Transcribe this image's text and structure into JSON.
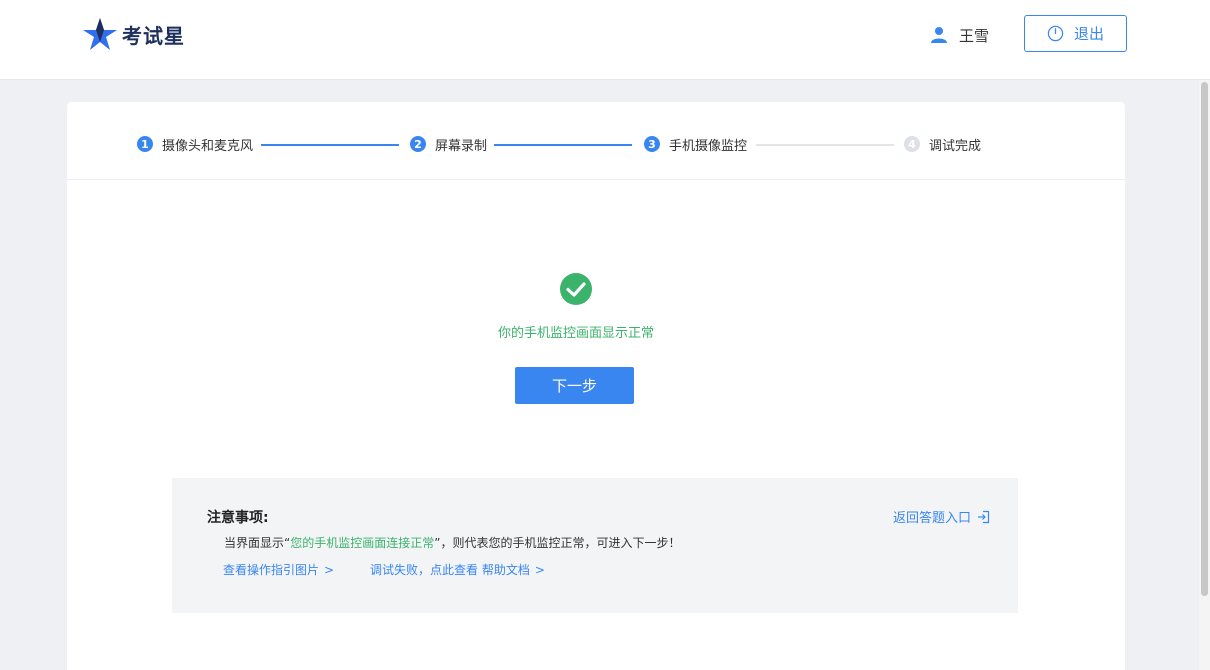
{
  "header": {
    "logo_text": "考试星",
    "user_name": "王雪",
    "logout_label": "退出"
  },
  "steps": [
    {
      "num": "1",
      "label": "摄像头和麦克风",
      "state": "done"
    },
    {
      "num": "2",
      "label": "屏幕录制",
      "state": "done"
    },
    {
      "num": "3",
      "label": "手机摄像监控",
      "state": "current"
    },
    {
      "num": "4",
      "label": "调试完成",
      "state": "pending"
    }
  ],
  "result": {
    "message": "你的手机监控画面显示正常",
    "next_label": "下一步"
  },
  "notice": {
    "title": "注意事项:",
    "text_prefix": "当界面显示“",
    "text_highlight": "您的手机监控画面连接正常",
    "text_suffix": "”，则代表您的手机监控正常，可进入下一步！",
    "guide_link": "查看操作指引图片",
    "help_link": "调试失败，点此查看 帮助文档",
    "return_link": "返回答题入口"
  },
  "colors": {
    "accent": "#3a86f0",
    "success": "#3bb36b",
    "logo": "#1d2f5c"
  }
}
